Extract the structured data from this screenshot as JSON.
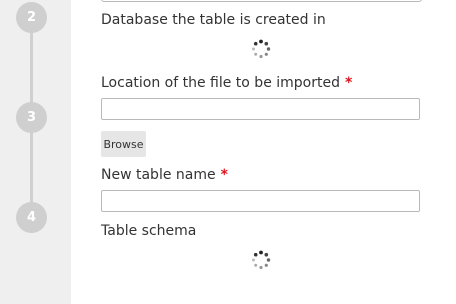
{
  "steps": [
    {
      "number": "2"
    },
    {
      "number": "3"
    },
    {
      "number": "4"
    }
  ],
  "form": {
    "database_label": "Database the table is created in",
    "file_location_label": "Location of the file to be imported",
    "file_location_required": "*",
    "file_location_value": "",
    "browse_label": "Browse",
    "table_name_label": "New table name",
    "table_name_required": "*",
    "table_name_value": "",
    "schema_label": "Table schema"
  },
  "icons": {
    "loading": "loading-spinner-icon"
  },
  "colors": {
    "sidebar": "#efefef",
    "step_circle": "#cfcfcf",
    "required": "#e1141d"
  }
}
